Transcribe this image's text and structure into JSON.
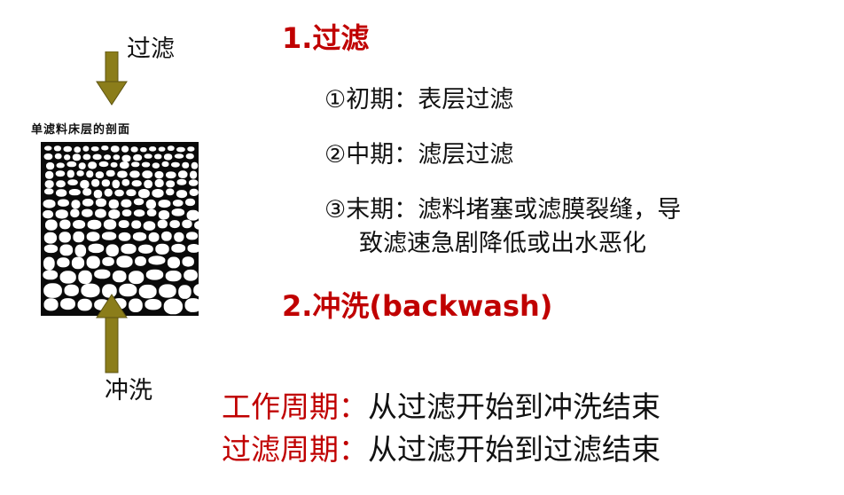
{
  "colors": {
    "heading": "#c00000",
    "arrow": "#8b7d1a",
    "text": "#111111"
  },
  "figure": {
    "label_top": "过滤",
    "label_bottom": "冲洗",
    "caption": "单滤料床层的剖面"
  },
  "sections": {
    "filtration": {
      "heading": "1.过滤",
      "items": [
        "①初期：表层过滤",
        "②中期：滤层过滤",
        "③末期：滤料堵塞或滤膜裂缝，导",
        "致滤速急剧降低或出水恶化"
      ]
    },
    "backwash": {
      "heading": "2.冲洗(backwash)"
    }
  },
  "definitions": [
    {
      "term": "工作周期",
      "sep": "：",
      "text": "从过滤开始到冲洗结束"
    },
    {
      "term": "过滤周期",
      "sep": "：",
      "text": "从过滤开始到过滤结束"
    }
  ]
}
